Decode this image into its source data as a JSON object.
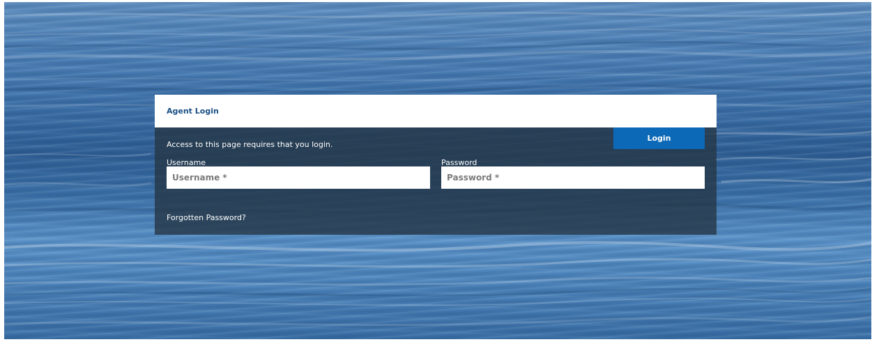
{
  "login": {
    "title": "Agent Login",
    "intro": "Access to this page requires that you login.",
    "username": {
      "label": "Username",
      "placeholder": "Username *",
      "value": ""
    },
    "password": {
      "label": "Password",
      "placeholder": "Password *",
      "value": ""
    },
    "submit_label": "Login",
    "forgot_label": "Forgotten Password?"
  },
  "colors": {
    "title": "#1b4f85",
    "button": "#0c69b7",
    "panel": "#263848"
  }
}
